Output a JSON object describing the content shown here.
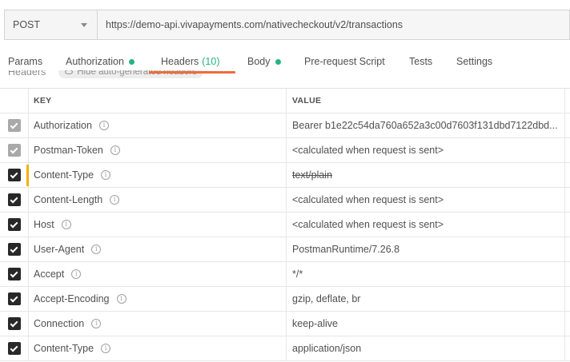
{
  "request": {
    "method": "POST",
    "url": "https://demo-api.vivapayments.com/nativecheckout/v2/transactions"
  },
  "tabs": [
    {
      "label": "Params",
      "dot": false,
      "count": ""
    },
    {
      "label": "Authorization",
      "dot": true,
      "count": ""
    },
    {
      "label": "Headers",
      "dot": false,
      "count": "(10)"
    },
    {
      "label": "Body",
      "dot": true,
      "count": ""
    },
    {
      "label": "Pre-request Script",
      "dot": false,
      "count": ""
    },
    {
      "label": "Tests",
      "dot": false,
      "count": ""
    },
    {
      "label": "Settings",
      "dot": false,
      "count": ""
    }
  ],
  "active_tab": "Headers",
  "section": {
    "title": "Headers",
    "hide_label": "Hide auto-generated headers"
  },
  "table": {
    "columns": {
      "key": "KEY",
      "value": "VALUE"
    },
    "rows": [
      {
        "key": "Authorization",
        "value": "Bearer b1e22c54da760a652a3c00d7603f131dbd7122dbd...",
        "checked": true,
        "disabled": true,
        "struck": false,
        "warning": false
      },
      {
        "key": "Postman-Token",
        "value": "<calculated when request is sent>",
        "checked": true,
        "disabled": true,
        "struck": false,
        "warning": false
      },
      {
        "key": "Content-Type",
        "value": "text/plain",
        "checked": true,
        "disabled": false,
        "struck": true,
        "warning": true
      },
      {
        "key": "Content-Length",
        "value": "<calculated when request is sent>",
        "checked": true,
        "disabled": false,
        "struck": false,
        "warning": false
      },
      {
        "key": "Host",
        "value": "<calculated when request is sent>",
        "checked": true,
        "disabled": false,
        "struck": false,
        "warning": false
      },
      {
        "key": "User-Agent",
        "value": "PostmanRuntime/7.26.8",
        "checked": true,
        "disabled": false,
        "struck": false,
        "warning": false
      },
      {
        "key": "Accept",
        "value": "*/*",
        "checked": true,
        "disabled": false,
        "struck": false,
        "warning": false
      },
      {
        "key": "Accept-Encoding",
        "value": "gzip, deflate, br",
        "checked": true,
        "disabled": false,
        "struck": false,
        "warning": false
      },
      {
        "key": "Connection",
        "value": "keep-alive",
        "checked": true,
        "disabled": false,
        "struck": false,
        "warning": false
      },
      {
        "key": "Content-Type",
        "value": "application/json",
        "checked": true,
        "disabled": false,
        "struck": false,
        "warning": false
      }
    ]
  },
  "colors": {
    "accent": "#f26b3a",
    "status_dot": "#26b47f",
    "warning": "#f4b000",
    "checkbox": "#282828",
    "checkbox_disabled": "#a9a9a9"
  }
}
